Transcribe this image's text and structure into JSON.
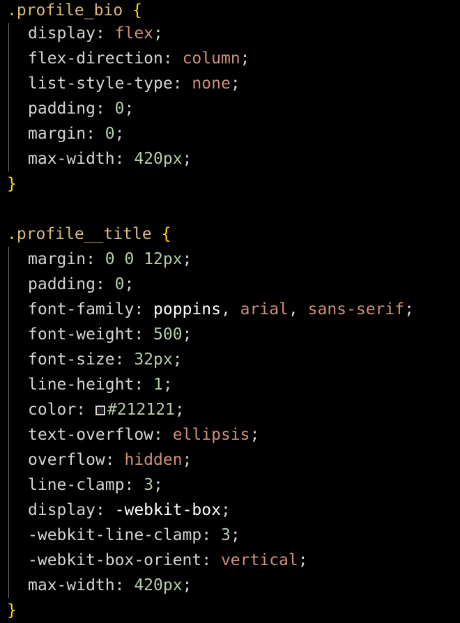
{
  "rules": [
    {
      "selector": ".profile_bio",
      "open_brace": "{",
      "close_brace": "}",
      "declarations": [
        {
          "property": "display",
          "value": "flex",
          "value_kind": "keyword"
        },
        {
          "property": "flex-direction",
          "value": "column",
          "value_kind": "keyword"
        },
        {
          "property": "list-style-type",
          "value": "none",
          "value_kind": "keyword"
        },
        {
          "property": "padding",
          "value": "0",
          "value_kind": "number"
        },
        {
          "property": "margin",
          "value": "0",
          "value_kind": "number"
        },
        {
          "property": "max-width",
          "value": "420px",
          "value_kind": "number"
        }
      ]
    },
    {
      "selector": ".profile__title",
      "open_brace": "{",
      "close_brace": "}",
      "declarations": [
        {
          "property": "margin",
          "value": "0 0 12px",
          "value_kind": "number"
        },
        {
          "property": "padding",
          "value": "0",
          "value_kind": "number"
        },
        {
          "property": "font-family",
          "value_parts": [
            "poppins",
            "arial",
            "sans-serif"
          ],
          "value_kind": "font-list"
        },
        {
          "property": "font-weight",
          "value": "500",
          "value_kind": "number"
        },
        {
          "property": "font-size",
          "value": "32px",
          "value_kind": "number"
        },
        {
          "property": "line-height",
          "value": "1",
          "value_kind": "number"
        },
        {
          "property": "color",
          "value": "#212121",
          "value_kind": "color",
          "swatch_color": "#212121"
        },
        {
          "property": "text-overflow",
          "value": "ellipsis",
          "value_kind": "keyword"
        },
        {
          "property": "overflow",
          "value": "hidden",
          "value_kind": "keyword"
        },
        {
          "property": "line-clamp",
          "value": "3",
          "value_kind": "number"
        },
        {
          "property": "display",
          "value": "-webkit-box",
          "value_kind": "ident"
        },
        {
          "property": "-webkit-line-clamp",
          "value": "3",
          "value_kind": "number"
        },
        {
          "property": "-webkit-box-orient",
          "value": "vertical",
          "value_kind": "keyword"
        },
        {
          "property": "max-width",
          "value": "420px",
          "value_kind": "number"
        }
      ]
    }
  ],
  "theme": {
    "background": "#000000",
    "selector_color": "#d7ba7d",
    "brace_color": "#ffd700",
    "keyword_value_color": "#ce9178",
    "number_value_color": "#b5cea8",
    "text_color": "#d4d4d4"
  }
}
